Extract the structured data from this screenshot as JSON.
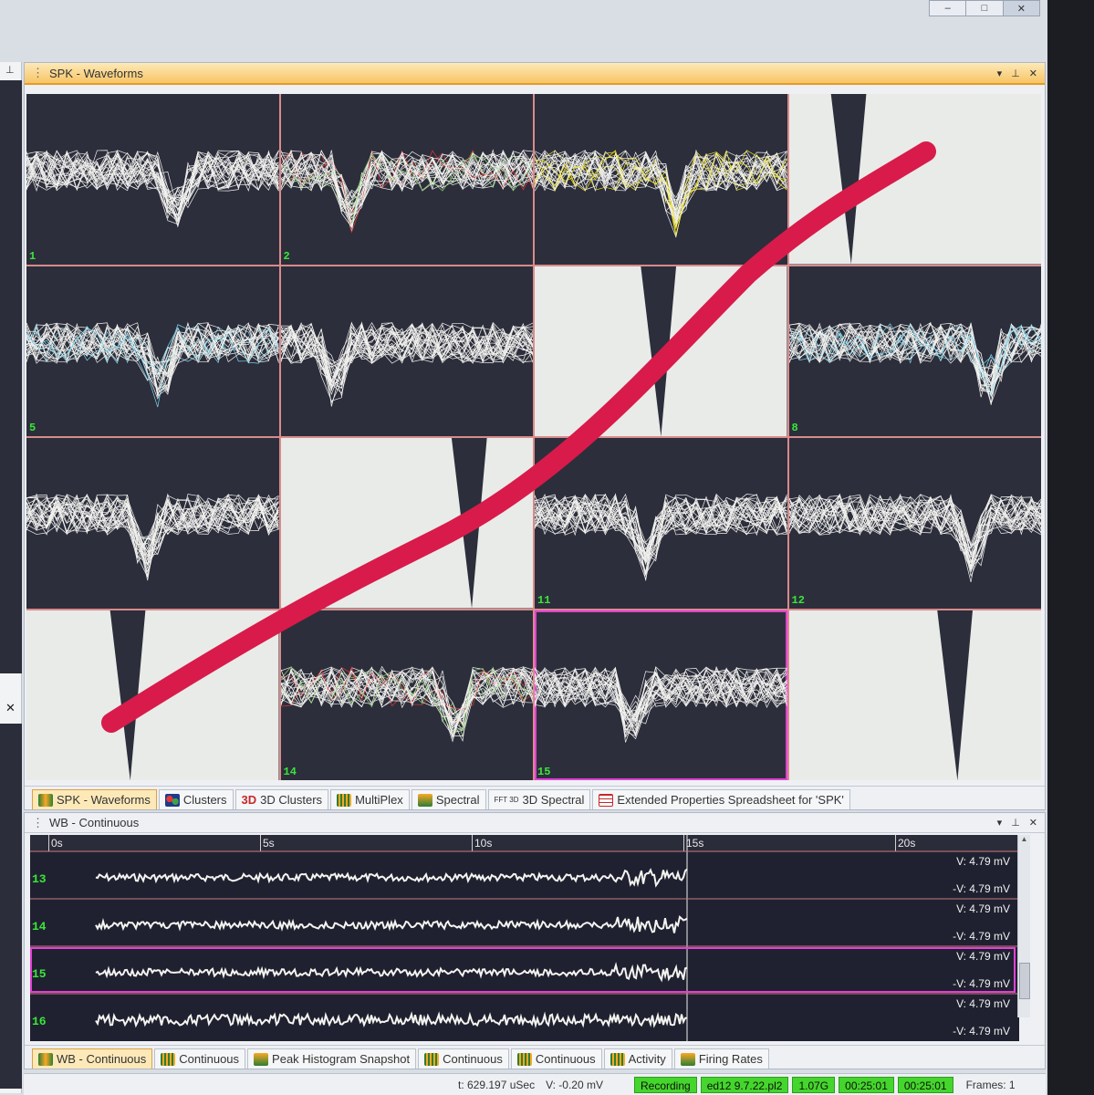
{
  "spk_panel": {
    "title": "SPK - Waveforms",
    "cells": [
      {
        "label": "1",
        "selected": false
      },
      {
        "label": "2",
        "selected": false
      },
      {
        "label": "",
        "selected": false
      },
      {
        "label": "",
        "selected": false
      },
      {
        "label": "5",
        "selected": false
      },
      {
        "label": "",
        "selected": false
      },
      {
        "label": "",
        "selected": false
      },
      {
        "label": "8",
        "selected": false
      },
      {
        "label": "",
        "selected": false
      },
      {
        "label": "",
        "selected": false
      },
      {
        "label": "11",
        "selected": false
      },
      {
        "label": "12",
        "selected": false
      },
      {
        "label": "",
        "selected": false
      },
      {
        "label": "14",
        "selected": false
      },
      {
        "label": "15",
        "selected": true
      },
      {
        "label": "",
        "selected": false
      }
    ],
    "tabs": [
      {
        "label": "SPK - Waveforms",
        "icon": "waveform-icon",
        "active": true
      },
      {
        "label": "Clusters",
        "icon": "clusters-icon"
      },
      {
        "label": "3D Clusters",
        "icon": "3d-clusters-icon",
        "prefix": "3D"
      },
      {
        "label": "MultiPlex",
        "icon": "multiplex-icon"
      },
      {
        "label": "Spectral",
        "icon": "spectral-icon"
      },
      {
        "label": "3D Spectral",
        "icon": "fft-3d-icon",
        "prefix": "FFT 3D"
      },
      {
        "label": "Extended Properties Spreadsheet for 'SPK'",
        "icon": "spreadsheet-icon"
      }
    ]
  },
  "wb_panel": {
    "title": "WB - Continuous",
    "ruler": [
      "0s",
      "5s",
      "10s",
      "15s",
      "20s"
    ],
    "channels": [
      {
        "label": "13",
        "v_top": "V: 4.79 mV",
        "v_bottom": "-V: 4.79 mV"
      },
      {
        "label": "14",
        "v_top": "V: 4.79 mV",
        "v_bottom": "-V: 4.79 mV"
      },
      {
        "label": "15",
        "v_top": "V: 4.79 mV",
        "v_bottom": "-V: 4.79 mV",
        "selected": true
      },
      {
        "label": "16",
        "v_top": "V: 4.79 mV",
        "v_bottom": "-V: 4.79 mV"
      }
    ],
    "tabs": [
      {
        "label": "WB - Continuous",
        "icon": "waveform-icon",
        "active": true
      },
      {
        "label": "Continuous",
        "icon": "continuous-icon"
      },
      {
        "label": "Peak Histogram Snapshot",
        "icon": "histogram-icon"
      },
      {
        "label": "Continuous",
        "icon": "continuous-icon"
      },
      {
        "label": "Continuous",
        "icon": "continuous-icon"
      },
      {
        "label": "Activity",
        "icon": "activity-icon"
      },
      {
        "label": "Firing Rates",
        "icon": "firing-rates-icon"
      }
    ]
  },
  "status": {
    "time": "t: 629.197 uSec",
    "voltage": "V: -0.20 mV",
    "recording": "Recording",
    "file": "ed12 9.7.22.pl2",
    "size": "1.07G",
    "elapsed1": "00:25:01",
    "elapsed2": "00:25:01",
    "frames": "Frames: 1"
  },
  "colors": {
    "accent": "#f7c566",
    "status_green": "#44d62c",
    "selection": "#e23fd6",
    "strike": "#d81b4a"
  }
}
